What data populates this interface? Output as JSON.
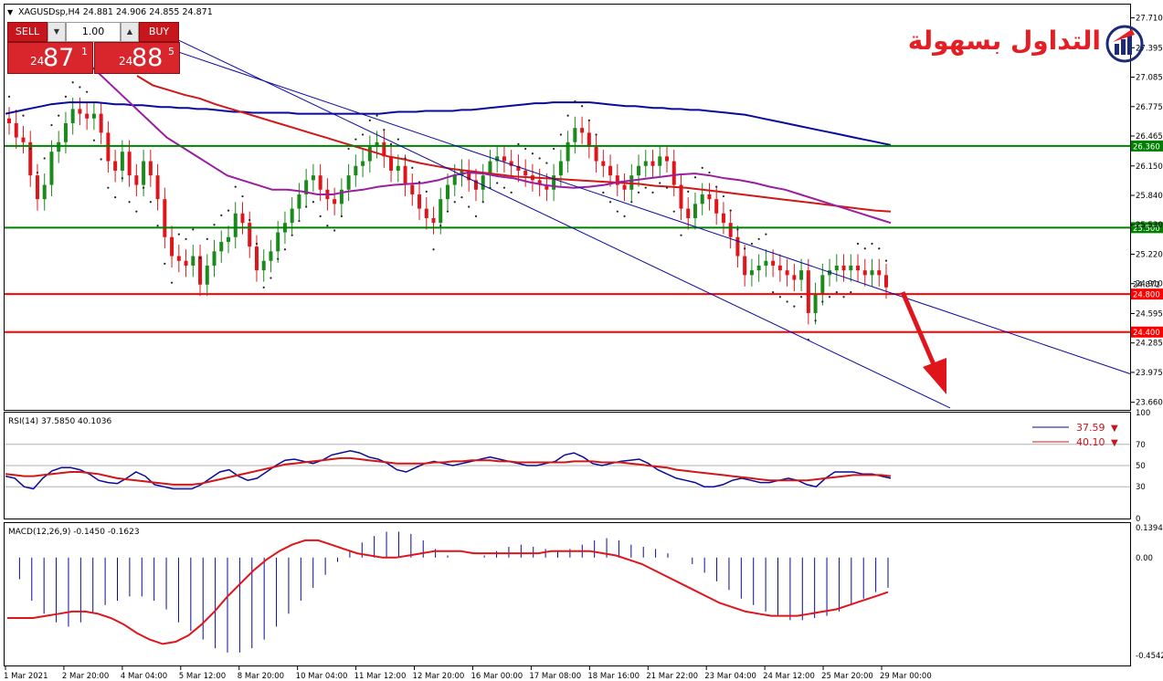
{
  "header": {
    "symbol": "XAGUSDsp,H4",
    "ohlc": "24.881 24.906 24.855 24.871"
  },
  "trade_panel": {
    "sell_label": "SELL",
    "buy_label": "BUY",
    "lot": "1.00",
    "sell_prefix": "24",
    "sell_big": "87",
    "sell_sup": "1",
    "buy_prefix": "24",
    "buy_big": "88",
    "buy_sup": "5"
  },
  "logo": {
    "text": "التداول بسهولة"
  },
  "colors": {
    "bull": "#1a8a1a",
    "bear": "#e0151b",
    "support_line": "#ff0000",
    "resistance_line": "#008000",
    "ma_slow": "#0a0a9a",
    "ma_mid": "#d01818",
    "ma_fast": "#9a1ea0",
    "channel": "#0a0aa0"
  },
  "chart_data": [
    {
      "type": "line",
      "name": "price",
      "y_ticks": [
        "27.710",
        "27.395",
        "27.085",
        "26.775",
        "26.465",
        "26.150",
        "25.840",
        "25.530",
        "25.220",
        "24.910",
        "24.595",
        "24.285",
        "23.975",
        "23.660"
      ],
      "ylim": [
        23.58,
        27.85
      ],
      "price_labels": [
        "26.360",
        "25.500",
        "24.871",
        "24.800",
        "24.400"
      ],
      "horizontal_levels": [
        {
          "value": 26.36,
          "kind": "resistance"
        },
        {
          "value": 25.5,
          "kind": "resistance"
        },
        {
          "value": 24.8,
          "kind": "support"
        },
        {
          "value": 24.4,
          "kind": "support"
        }
      ],
      "x_labels": [
        "1 Mar 2021",
        "2 Mar 20:00",
        "4 Mar 04:00",
        "5 Mar 12:00",
        "8 Mar 20:00",
        "10 Mar 04:00",
        "11 Mar 12:00",
        "12 Mar 20:00",
        "16 Mar 00:00",
        "17 Mar 08:00",
        "18 Mar 16:00",
        "21 Mar 22:00",
        "23 Mar 04:00",
        "24 Mar 12:00",
        "25 Mar 20:00",
        "29 Mar 00:00"
      ],
      "close": [
        26.6,
        26.45,
        26.4,
        26.05,
        25.8,
        25.95,
        26.3,
        26.4,
        26.6,
        26.75,
        26.7,
        26.65,
        26.7,
        26.5,
        26.2,
        26.1,
        26.3,
        26.05,
        25.95,
        26.2,
        26.05,
        25.8,
        25.4,
        25.2,
        25.15,
        25.1,
        25.2,
        24.9,
        25.1,
        25.25,
        25.35,
        25.4,
        25.65,
        25.55,
        25.3,
        25.05,
        25.15,
        25.25,
        25.45,
        25.55,
        25.7,
        25.85,
        26.0,
        26.05,
        25.9,
        25.8,
        25.75,
        25.9,
        26.05,
        26.15,
        26.2,
        26.35,
        26.4,
        26.25,
        26.1,
        26.15,
        25.95,
        25.85,
        25.7,
        25.6,
        25.55,
        25.8,
        25.95,
        26.05,
        26.1,
        26.0,
        25.9,
        26.05,
        26.2,
        26.25,
        26.2,
        26.15,
        26.1,
        26.05,
        26.0,
        25.95,
        25.9,
        26.05,
        26.2,
        26.4,
        26.55,
        26.5,
        26.35,
        26.2,
        26.15,
        26.05,
        25.95,
        25.9,
        26.05,
        26.15,
        26.2,
        26.15,
        26.25,
        26.2,
        25.95,
        25.7,
        25.6,
        25.75,
        25.85,
        25.8,
        25.65,
        25.55,
        25.4,
        25.2,
        25.0,
        25.05,
        25.1,
        25.15,
        25.1,
        25.05,
        25.0,
        24.95,
        25.05,
        24.6,
        24.8,
        25.0,
        25.05,
        25.1,
        25.05,
        25.1,
        25.05,
        25.0,
        25.05,
        25.0,
        24.871
      ],
      "ma_slow": [
        26.7,
        26.72,
        26.74,
        26.76,
        26.78,
        26.8,
        26.81,
        26.82,
        26.82,
        26.82,
        26.82,
        26.81,
        26.8,
        26.8,
        26.79,
        26.79,
        26.78,
        26.77,
        26.77,
        26.76,
        26.76,
        26.75,
        26.75,
        26.74,
        26.73,
        26.72,
        26.72,
        26.71,
        26.71,
        26.71,
        26.71,
        26.71,
        26.7,
        26.7,
        26.7,
        26.7,
        26.7,
        26.7,
        26.7,
        26.7,
        26.7,
        26.7,
        26.71,
        26.72,
        26.72,
        26.72,
        26.73,
        26.73,
        26.73,
        26.73,
        26.74,
        26.74,
        26.75,
        26.76,
        26.77,
        26.78,
        26.79,
        26.8,
        26.81,
        26.81,
        26.82,
        26.82,
        26.82,
        26.82,
        26.82,
        26.81,
        26.8,
        26.79,
        26.78,
        26.78,
        26.77,
        26.76,
        26.76,
        26.75,
        26.75,
        26.74,
        26.74,
        26.73,
        26.72,
        26.71,
        26.7,
        26.69,
        26.67,
        26.65,
        26.63,
        26.61,
        26.59,
        26.57,
        26.55,
        26.53,
        26.51,
        26.49,
        26.47,
        26.45,
        26.43,
        26.41,
        26.39,
        26.37
      ],
      "ma_mid": [
        27.1,
        27.0,
        26.95,
        26.9,
        26.86,
        26.8,
        26.75,
        26.7,
        26.65,
        26.6,
        26.55,
        26.5,
        26.45,
        26.4,
        26.35,
        26.3,
        26.25,
        26.22,
        26.18,
        26.15,
        26.12,
        26.1,
        26.08,
        26.06,
        26.04,
        26.03,
        26.02,
        26.01,
        26.0,
        25.99,
        25.98,
        25.97,
        25.96,
        25.94,
        25.93,
        25.92,
        25.9,
        25.88,
        25.86,
        25.84,
        25.82,
        25.8,
        25.78,
        25.76,
        25.74,
        25.72,
        25.7,
        25.68,
        25.67
      ],
      "ma_fast": [
        27.2,
        27.05,
        26.9,
        26.75,
        26.6,
        26.45,
        26.35,
        26.25,
        26.15,
        26.05,
        26.0,
        25.95,
        25.9,
        25.9,
        25.88,
        25.85,
        25.85,
        25.88,
        25.9,
        25.93,
        25.95,
        25.96,
        25.97,
        26.0,
        26.05,
        26.08,
        26.07,
        26.04,
        26.02,
        25.98,
        25.95,
        25.93,
        25.92,
        25.93,
        25.95,
        25.98,
        26.0,
        26.02,
        26.04,
        26.06,
        26.07,
        26.05,
        26.02,
        26.0,
        25.97,
        25.93,
        25.9,
        25.85,
        25.8,
        25.75,
        25.7,
        25.65,
        25.6,
        25.55
      ]
    },
    {
      "type": "line",
      "name": "RSI(14)",
      "title": "RSI(14) 37.5850 40.1036",
      "y_ticks": [
        "100",
        "70",
        "50",
        "30",
        "0"
      ],
      "levels": [
        70,
        50,
        30
      ],
      "ylim": [
        0,
        100
      ],
      "series": [
        {
          "name": "37.59",
          "values": [
            40,
            38,
            30,
            28,
            38,
            45,
            48,
            48,
            46,
            42,
            36,
            34,
            33,
            38,
            44,
            40,
            32,
            30,
            28,
            28,
            28,
            32,
            38,
            44,
            46,
            40,
            36,
            38,
            44,
            50,
            55,
            56,
            54,
            52,
            55,
            60,
            62,
            64,
            62,
            58,
            56,
            52,
            46,
            44,
            48,
            52,
            54,
            52,
            50,
            52,
            54,
            56,
            58,
            56,
            54,
            52,
            50,
            50,
            52,
            54,
            60,
            62,
            58,
            52,
            50,
            52,
            54,
            55,
            56,
            52,
            46,
            42,
            38,
            36,
            34,
            30,
            30,
            32,
            36,
            38,
            36,
            34,
            34,
            36,
            38,
            36,
            32,
            30,
            38,
            44,
            44,
            44,
            42,
            42,
            40,
            38
          ]
        },
        {
          "name": "40.10",
          "values": [
            42,
            41,
            40,
            40,
            41,
            42,
            43,
            44,
            44,
            43,
            42,
            40,
            38,
            37,
            36,
            35,
            34,
            33,
            32,
            32,
            32,
            33,
            35,
            37,
            39,
            41,
            43,
            45,
            47,
            49,
            51,
            52,
            53,
            54,
            55,
            56,
            57,
            57,
            56,
            55,
            54,
            53,
            52,
            52,
            52,
            52,
            53,
            53,
            54,
            54,
            55,
            55,
            55,
            54,
            54,
            53,
            53,
            53,
            53,
            53,
            53,
            54,
            54,
            54,
            53,
            53,
            53,
            52,
            51,
            50,
            49,
            48,
            46,
            45,
            44,
            43,
            42,
            41,
            40,
            39,
            38,
            37,
            36,
            36,
            36,
            36,
            36,
            37,
            38,
            39,
            40,
            41,
            41,
            41,
            41,
            40
          ]
        }
      ]
    },
    {
      "type": "bar",
      "name": "MACD(12,26,9)",
      "title": "MACD(12,26,9) -0.1450 -0.1623",
      "y_ticks": [
        "0.1394",
        "0.00",
        "-0.4542"
      ],
      "ylim": [
        -0.5,
        0.16
      ],
      "values": [
        0.0,
        -0.1,
        -0.2,
        -0.26,
        -0.3,
        -0.32,
        -0.3,
        -0.26,
        -0.22,
        -0.2,
        -0.18,
        -0.18,
        -0.2,
        -0.24,
        -0.3,
        -0.34,
        -0.38,
        -0.42,
        -0.44,
        -0.44,
        -0.42,
        -0.38,
        -0.32,
        -0.26,
        -0.2,
        -0.14,
        -0.08,
        -0.02,
        0.03,
        0.07,
        0.1,
        0.12,
        0.12,
        0.11,
        0.08,
        0.04,
        0.01,
        0.0,
        0.0,
        0.01,
        0.03,
        0.05,
        0.06,
        0.05,
        0.04,
        0.03,
        0.04,
        0.06,
        0.08,
        0.09,
        0.08,
        0.06,
        0.05,
        0.04,
        0.02,
        0.0,
        -0.03,
        -0.07,
        -0.11,
        -0.15,
        -0.19,
        -0.22,
        -0.25,
        -0.27,
        -0.29,
        -0.29,
        -0.28,
        -0.27,
        -0.25,
        -0.22,
        -0.19,
        -0.16,
        -0.14
      ],
      "signal": [
        -0.28,
        -0.28,
        -0.28,
        -0.27,
        -0.26,
        -0.25,
        -0.25,
        -0.26,
        -0.28,
        -0.31,
        -0.35,
        -0.38,
        -0.4,
        -0.39,
        -0.36,
        -0.31,
        -0.25,
        -0.18,
        -0.12,
        -0.06,
        -0.01,
        0.03,
        0.06,
        0.08,
        0.08,
        0.06,
        0.04,
        0.02,
        0.01,
        0.0,
        0.0,
        0.01,
        0.02,
        0.03,
        0.03,
        0.03,
        0.02,
        0.02,
        0.02,
        0.02,
        0.02,
        0.02,
        0.03,
        0.03,
        0.03,
        0.03,
        0.02,
        0.01,
        -0.01,
        -0.03,
        -0.06,
        -0.09,
        -0.12,
        -0.15,
        -0.18,
        -0.21,
        -0.23,
        -0.25,
        -0.26,
        -0.27,
        -0.27,
        -0.27,
        -0.26,
        -0.25,
        -0.24,
        -0.22,
        -0.2,
        -0.18,
        -0.16
      ]
    }
  ]
}
